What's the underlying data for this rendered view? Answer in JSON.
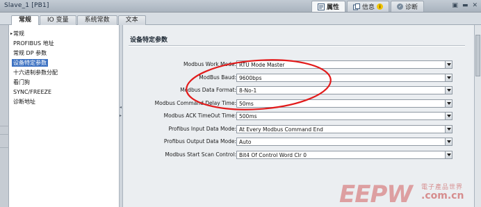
{
  "window": {
    "title": "Slave_1 [PB1]",
    "controls": [
      "▣",
      "▬",
      "✕"
    ]
  },
  "inspector_tabs": [
    {
      "icon": "properties-icon",
      "label": "属性",
      "active": true
    },
    {
      "icon": "info-icon",
      "label": "信息",
      "active": false
    },
    {
      "icon": "diagnostics-icon",
      "label": "诊断",
      "active": false
    }
  ],
  "tabs": [
    {
      "label": "常规",
      "active": true
    },
    {
      "label": "IO 变量",
      "active": false
    },
    {
      "label": "系统常数",
      "active": false
    },
    {
      "label": "文本",
      "active": false
    }
  ],
  "nav": {
    "items": [
      {
        "label": "常规",
        "selected": false,
        "expander": "▸"
      },
      {
        "label": "PROFIBUS 地址",
        "selected": false
      },
      {
        "label": "常规 DP 参数",
        "selected": false
      },
      {
        "label": "设备特定参数",
        "selected": true
      },
      {
        "label": "十六进制参数分配",
        "selected": false
      },
      {
        "label": "看门狗",
        "selected": false
      },
      {
        "label": "SYNC/FREEZE",
        "selected": false
      },
      {
        "label": "诊断地址",
        "selected": false
      }
    ]
  },
  "section": {
    "title": "设备特定参数"
  },
  "params": [
    {
      "label": "Modbus Work Mode:",
      "value": "RTU Mode Master"
    },
    {
      "label": "ModBus Baud:",
      "value": "9600bps"
    },
    {
      "label": "Modbus Data Format:",
      "value": "8-No-1"
    },
    {
      "label": "Modbus Command Delay Time:",
      "value": "50ms"
    },
    {
      "label": "Modbus ACK TimeOut Time:",
      "value": "500ms"
    },
    {
      "label": "Profibus Input Data Mode:",
      "value": "At Every Modbus Command End"
    },
    {
      "label": "Profibus Output Data Mode:",
      "value": "Auto"
    },
    {
      "label": "Modbus Start Scan Control:",
      "value": "Bit4 Of Control Word Clr 0"
    }
  ],
  "annotation": {
    "color": "#e21b1b"
  },
  "colors": {
    "selection": "#3d72c2",
    "panel": "#ebeef1"
  }
}
